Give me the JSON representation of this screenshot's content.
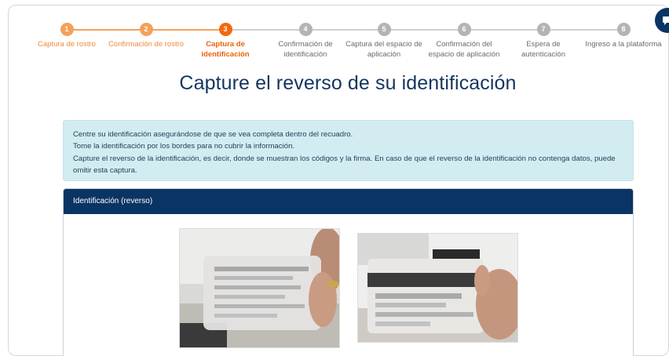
{
  "steps": [
    {
      "number": "1",
      "label": "Captura de rostro",
      "state": "done"
    },
    {
      "number": "2",
      "label": "Confirmación de rostro",
      "state": "done"
    },
    {
      "number": "3",
      "label": "Captura de identificación",
      "state": "active"
    },
    {
      "number": "4",
      "label": "Confirmación de identificación",
      "state": "todo"
    },
    {
      "number": "5",
      "label": "Captura del espacio de aplicación",
      "state": "todo"
    },
    {
      "number": "6",
      "label": "Confirmación del espacio de aplicación",
      "state": "todo"
    },
    {
      "number": "7",
      "label": "Espera de autenticación",
      "state": "todo"
    },
    {
      "number": "8",
      "label": "Ingreso a la plataforma",
      "state": "todo"
    }
  ],
  "page_title": "Capture el reverso de su identificación",
  "instructions": [
    "Centre su identificación asegurándose de que se vea completa dentro del recuadro.",
    "Tome la identificación por los bordes para no cubrir la información.",
    "Capture el reverso de la identificación, es decir, donde se muestran los códigos y la firma. En caso de que el reverso de la identificación no contenga datos, puede omitir esta captura."
  ],
  "card": {
    "header": "Identificación (reverso)"
  },
  "colors": {
    "done": "#f5a05a",
    "active": "#f26a0f",
    "todo": "#b4b4b4",
    "navy": "#0a3463",
    "info_bg": "#d3ecf2"
  },
  "icons": {
    "chat": "chat-bubble-icon"
  }
}
